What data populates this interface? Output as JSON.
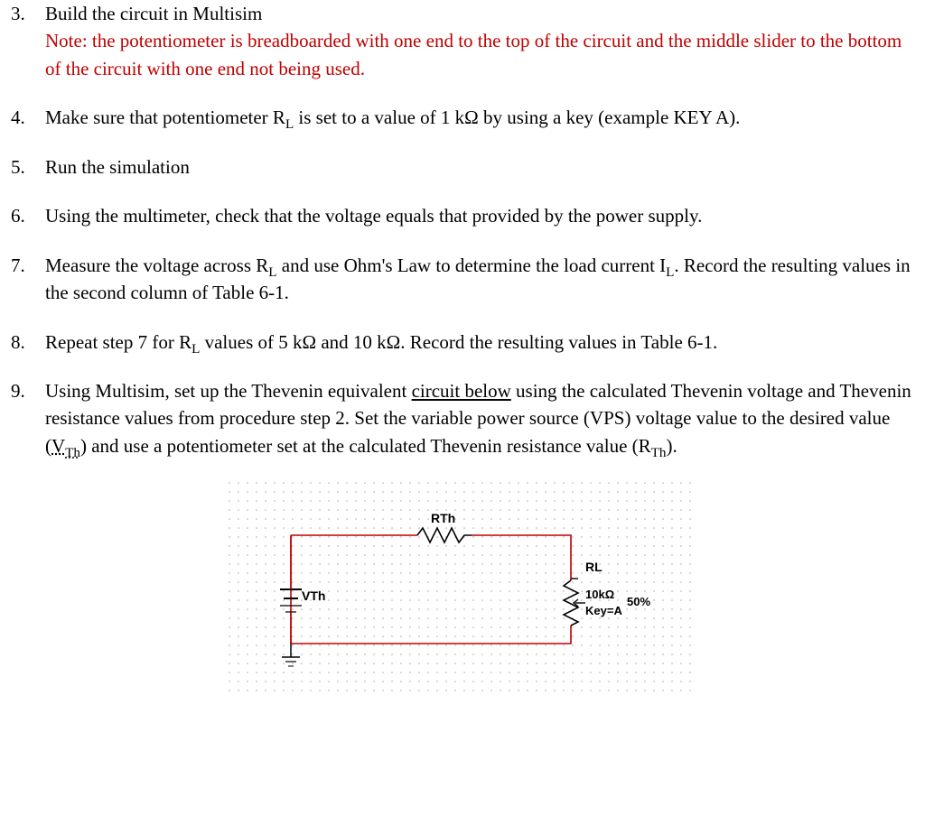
{
  "steps": [
    {
      "num": "3.",
      "text": "Build the circuit in Multisim",
      "note": "Note: the potentiometer is breadboarded with one end to the top of the circuit and the middle slider to the bottom of the circuit with one end not being used."
    },
    {
      "num": "4.",
      "text_pre": "Make sure that potentiometer R",
      "text_sub": "L",
      "text_post": "is set to a value of 1 kΩ by using a key (example KEY A)."
    },
    {
      "num": "5.",
      "text": "Run the simulation"
    },
    {
      "num": "6.",
      "text": "Using the multimeter, check that the voltage equals that provided by the power supply."
    },
    {
      "num": "7.",
      "text_pre": "Measure the voltage across R",
      "text_sub": "L",
      "text_mid": " and use Ohm's Law to determine the load current I",
      "text_sub2": "L",
      "text_post": ".  Record the resulting values in the second column of Table 6-1."
    },
    {
      "num": "8.",
      "text_pre": "Repeat step 7 for R",
      "text_sub": "L",
      "text_post": " values of 5 kΩ and 10 kΩ.  Record the resulting values in Table 6-1."
    },
    {
      "num": "9.",
      "text_pre": "Using Multisim, set up the Thevenin equivalent ",
      "underline": "circuit  below",
      "text_mid": " using the calculated Thevenin voltage and Thevenin resistance values from procedure step 2. Set the variable power source (VPS) voltage value to the desired value (",
      "vth_label": "V",
      "vth_sub": "Th",
      "text_mid2": ") and use a potentiometer set at the calculated Thevenin resistance value (R",
      "rth_sub": "Th",
      "text_post": ")."
    }
  ],
  "diagram": {
    "rth_label": "RTh",
    "vth_label": "VTh",
    "rl_label": "RL",
    "pot_value": "10kΩ",
    "pot_key": "Key=A",
    "pot_percent": "50%"
  }
}
